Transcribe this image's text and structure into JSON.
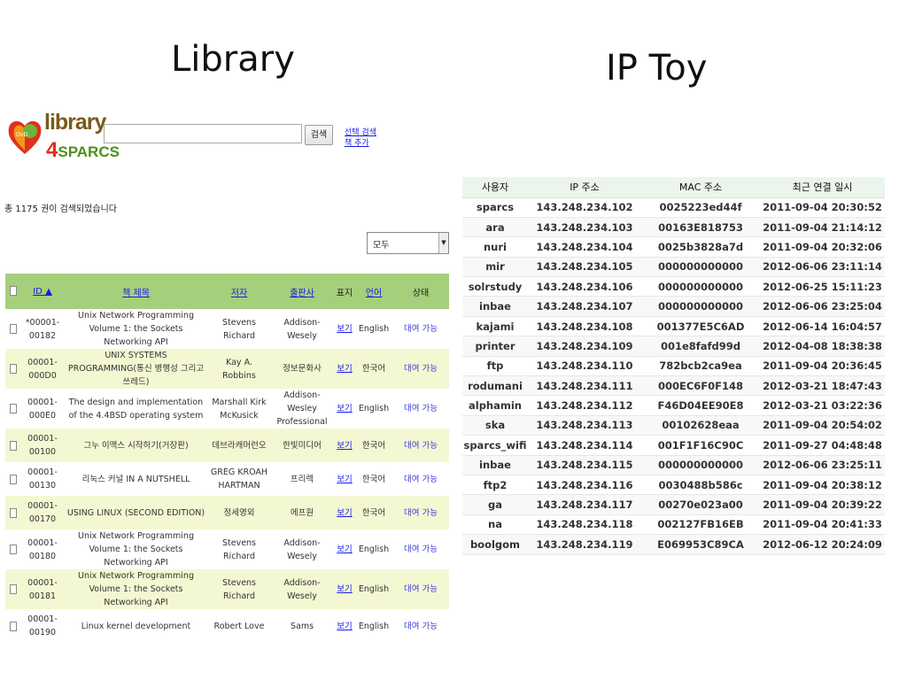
{
  "titles": {
    "left": "Library",
    "right": "IP Toy"
  },
  "library": {
    "logo": {
      "word_top": "library",
      "word_bottom_num": "4",
      "word_bottom_text": "SPARCS",
      "badge": "DVD"
    },
    "search": {
      "value": "",
      "button": "검색",
      "link_advanced": "선택 검색",
      "link_add": "책 추가"
    },
    "result_count": "총 1175 권이 검색되었습니다",
    "filter": {
      "selected": "모두"
    },
    "columns": [
      "ID ▲",
      "책 제목",
      "저자",
      "출판사",
      "표지",
      "언어",
      "상태"
    ],
    "rows": [
      {
        "id": "*00001-00182",
        "title": "Unix Network Programming Volume 1: the Sockets Networking API",
        "author": "Stevens Richard",
        "publisher": "Addison-Wesely",
        "cover": "보기",
        "lang": "English",
        "status": "대여 가능"
      },
      {
        "id": "00001-000D0",
        "title": "UNIX SYSTEMS PROGRAMMING(통신 병행성 그리고 쓰레드)",
        "author": "Kay A. Robbins",
        "publisher": "정보문화사",
        "cover": "보기",
        "lang": "한국어",
        "status": "대여 가능"
      },
      {
        "id": "00001-000E0",
        "title": "The design and implementation of the 4.4BSD operating system",
        "author": "Marshall Kirk McKusick",
        "publisher": "Addison-Wesley Professional",
        "cover": "보기",
        "lang": "English",
        "status": "대여 가능"
      },
      {
        "id": "00001-00100",
        "title": "그누 이맥스 시작하기(거장판)",
        "author": "데브라캐머런오",
        "publisher": "한빛미디어",
        "cover": "보기",
        "lang": "한국어",
        "status": "대여 가능"
      },
      {
        "id": "00001-00130",
        "title": "리눅스 커널 IN A NUTSHELL",
        "author": "GREG KROAH HARTMAN",
        "publisher": "프리렉",
        "cover": "보기",
        "lang": "한국어",
        "status": "대여 가능"
      },
      {
        "id": "00001-00170",
        "title": "USING LINUX (SECOND EDITION)",
        "author": "정세영외",
        "publisher": "에프원",
        "cover": "보기",
        "lang": "한국어",
        "status": "대여 가능"
      },
      {
        "id": "00001-00180",
        "title": "Unix Network Programming Volume 1: the Sockets Networking API",
        "author": "Stevens Richard",
        "publisher": "Addison-Wesely",
        "cover": "보기",
        "lang": "English",
        "status": "대여 가능"
      },
      {
        "id": "00001-00181",
        "title": "Unix Network Programming Volume 1: the Sockets Networking API",
        "author": "Stevens Richard",
        "publisher": "Addison-Wesely",
        "cover": "보기",
        "lang": "English",
        "status": "대여 가능"
      },
      {
        "id": "00001-00190",
        "title": "Linux kernel development",
        "author": "Robert Love",
        "publisher": "Sams",
        "cover": "보기",
        "lang": "English",
        "status": "대여 가능"
      }
    ]
  },
  "iptoy": {
    "columns": [
      "사용자",
      "IP 주소",
      "MAC 주소",
      "최근 연결 일시"
    ],
    "rows": [
      [
        "sparcs",
        "143.248.234.102",
        "0025223ed44f",
        "2011-09-04 20:30:52"
      ],
      [
        "ara",
        "143.248.234.103",
        "00163E818753",
        "2011-09-04 21:14:12"
      ],
      [
        "nuri",
        "143.248.234.104",
        "0025b3828a7d",
        "2011-09-04 20:32:06"
      ],
      [
        "mir",
        "143.248.234.105",
        "000000000000",
        "2012-06-06 23:11:14"
      ],
      [
        "solrstudy",
        "143.248.234.106",
        "000000000000",
        "2012-06-25 15:11:23"
      ],
      [
        "inbae",
        "143.248.234.107",
        "000000000000",
        "2012-06-06 23:25:04"
      ],
      [
        "kajami",
        "143.248.234.108",
        "001377E5C6AD",
        "2012-06-14 16:04:57"
      ],
      [
        "printer",
        "143.248.234.109",
        "001e8fafd99d",
        "2012-04-08 18:38:38"
      ],
      [
        "ftp",
        "143.248.234.110",
        "782bcb2ca9ea",
        "2011-09-04 20:36:45"
      ],
      [
        "rodumani",
        "143.248.234.111",
        "000EC6F0F148",
        "2012-03-21 18:47:43"
      ],
      [
        "alphamin",
        "143.248.234.112",
        "F46D04EE90E8",
        "2012-03-21 03:22:36"
      ],
      [
        "ska",
        "143.248.234.113",
        "00102628eaa",
        "2011-09-04 20:54:02"
      ],
      [
        "sparcs_wifi",
        "143.248.234.114",
        "001F1F16C90C",
        "2011-09-27 04:48:48"
      ],
      [
        "inbae",
        "143.248.234.115",
        "000000000000",
        "2012-06-06 23:25:11"
      ],
      [
        "ftp2",
        "143.248.234.116",
        "0030488b586c",
        "2011-09-04 20:38:12"
      ],
      [
        "ga",
        "143.248.234.117",
        "00270e023a00",
        "2011-09-04 20:39:22"
      ],
      [
        "na",
        "143.248.234.118",
        "002127FB16EB",
        "2011-09-04 20:41:33"
      ],
      [
        "boolgom",
        "143.248.234.119",
        "E069953C89CA",
        "2012-06-12 20:24:09"
      ]
    ]
  }
}
